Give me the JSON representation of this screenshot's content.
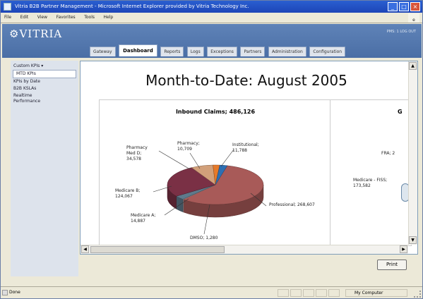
{
  "window": {
    "title": "Vitria B2B Partner Management - Microsoft Internet Explorer provided by Vitria Technology Inc."
  },
  "menu": [
    "File",
    "Edit",
    "View",
    "Favorites",
    "Tools",
    "Help"
  ],
  "app": {
    "logo": "VITRIA",
    "user_label": "PMS: 1 LOG OUT",
    "tabs": [
      {
        "label": "Gateway",
        "active": false
      },
      {
        "label": "Dashboard",
        "active": true
      },
      {
        "label": "Reports",
        "active": false
      },
      {
        "label": "Logs",
        "active": false
      },
      {
        "label": "Exceptions",
        "active": false
      },
      {
        "label": "Partners",
        "active": false
      },
      {
        "label": "Administration",
        "active": false
      },
      {
        "label": "Configuration",
        "active": false
      }
    ]
  },
  "sidebar": {
    "heading": "Custom KPIs ▾",
    "items": [
      {
        "label": "MTD KPIs",
        "selected": true
      },
      {
        "label": "KPIs by Date",
        "selected": false
      },
      {
        "label": "B2B KSLAs",
        "selected": false
      },
      {
        "label": "Realtime Performance",
        "selected": false
      }
    ]
  },
  "dashboard": {
    "title": "Month-to-Date: August 2005",
    "print_label": "Print",
    "partial_labels": {
      "title": "G",
      "fra": "FRA; 2",
      "medicare": "Medicare - FISS; 173,582"
    }
  },
  "chart_data": {
    "type": "pie",
    "title": "Inbound Claims; 486,126",
    "slices": [
      {
        "label": "Professional",
        "value": 268607,
        "color": "#a85a58"
      },
      {
        "label": "DMSO",
        "value": 1280,
        "color": "#b6c3c8"
      },
      {
        "label": "Medicare A",
        "value": 14887,
        "color": "#5e7a8c"
      },
      {
        "label": "Medicare B",
        "value": 124067,
        "color": "#7a3045"
      },
      {
        "label": "Pharmacy Med D",
        "value": 34578,
        "color": "#d2a07a"
      },
      {
        "label": "Pharmacy",
        "value": 10709,
        "color": "#e67a2a"
      },
      {
        "label": "Institutional",
        "value": 11788,
        "color": "#2d6fb3"
      }
    ],
    "slice_labels": [
      "Professional; 268,607",
      "DMSO; 1,280",
      "Medicare A; 14,887",
      "Medicare B; 124,067",
      "Pharmacy Med D; 34,578",
      "Pharmacy; 10,709",
      "Institutional; 11,788"
    ]
  },
  "status": {
    "left": "Done",
    "zone": "My Computer"
  },
  "colors": {
    "header": "#5f83b8",
    "titlebar": "#1d45b8",
    "sidebar": "#dde3ec"
  }
}
